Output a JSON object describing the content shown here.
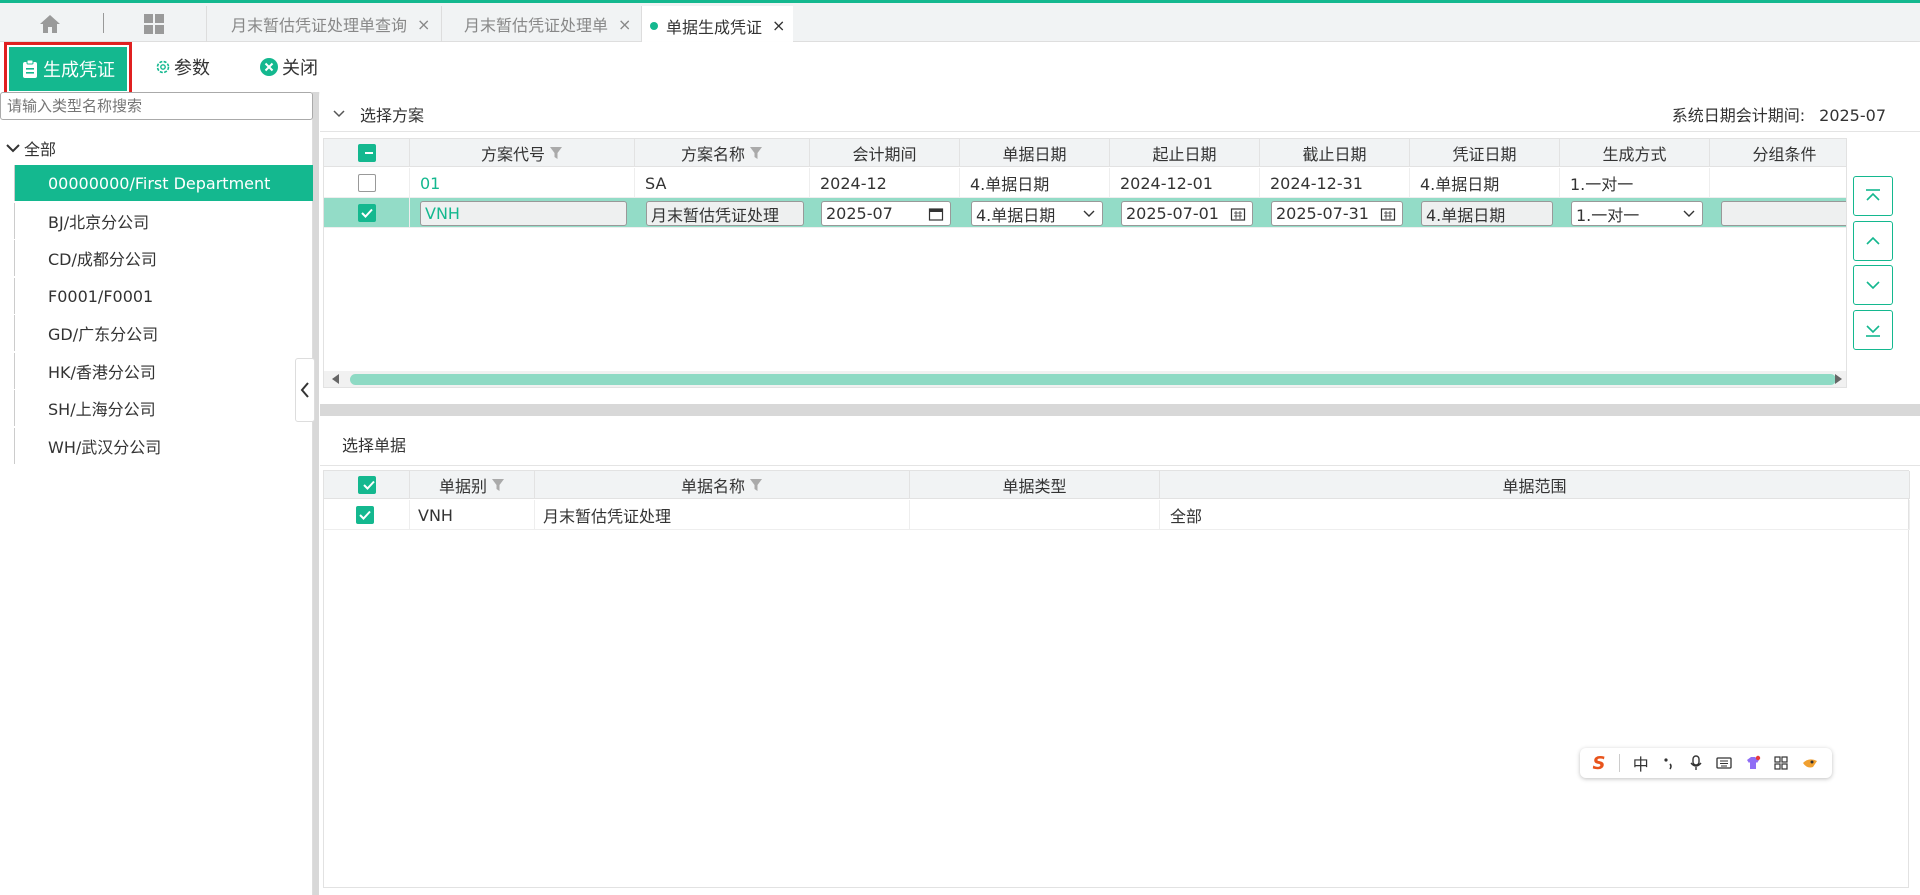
{
  "tabs": [
    {
      "label": "月末暂估凭证处理单查询"
    },
    {
      "label": "月末暂估凭证处理单"
    },
    {
      "label": "单据生成凭证"
    }
  ],
  "toolbar": {
    "generate_label": "生成凭证",
    "params_label": "参数",
    "close_label": "关闭"
  },
  "left": {
    "search_placeholder": "请输入类型名称搜索",
    "root_label": "全部",
    "items": [
      "00000000/First Department",
      "BJ/北京分公司",
      "CD/成都分公司",
      "F0001/F0001",
      "GD/广东分公司",
      "HK/香港分公司",
      "SH/上海分公司",
      "WH/武汉分公司"
    ]
  },
  "scheme": {
    "title": "选择方案",
    "sysdate_label": "系统日期会计期间:",
    "sysdate_value": "2025-07",
    "columns": [
      "方案代号",
      "方案名称",
      "会计期间",
      "单据日期",
      "起止日期",
      "截止日期",
      "凭证日期",
      "生成方式",
      "分组条件"
    ],
    "rows": [
      {
        "code": "01",
        "name": "SA",
        "period": "2024-12",
        "doc_date": "4.单据日期",
        "start": "2024-12-01",
        "end": "2024-12-31",
        "voucher_date": "4.单据日期",
        "mode": "1.一对一",
        "group": ""
      },
      {
        "code": "VNH",
        "name": "月末暂估凭证处理",
        "period": "2025-07",
        "doc_date": "4.单据日期",
        "start": "2025-07-01",
        "end": "2025-07-31",
        "voucher_date": "4.单据日期",
        "mode": "1.一对一",
        "group": ""
      }
    ]
  },
  "docs": {
    "title": "选择单据",
    "columns": [
      "单据别",
      "单据名称",
      "单据类型",
      "单据范围"
    ],
    "rows": [
      {
        "type_code": "VNH",
        "name": "月末暂估凭证处理",
        "type": "",
        "range": "全部"
      }
    ]
  },
  "ime": {
    "lang": "中"
  },
  "colors": {
    "accent": "#14b88f",
    "selected_row": "#93dcc7",
    "highlight_border": "#e02020"
  }
}
